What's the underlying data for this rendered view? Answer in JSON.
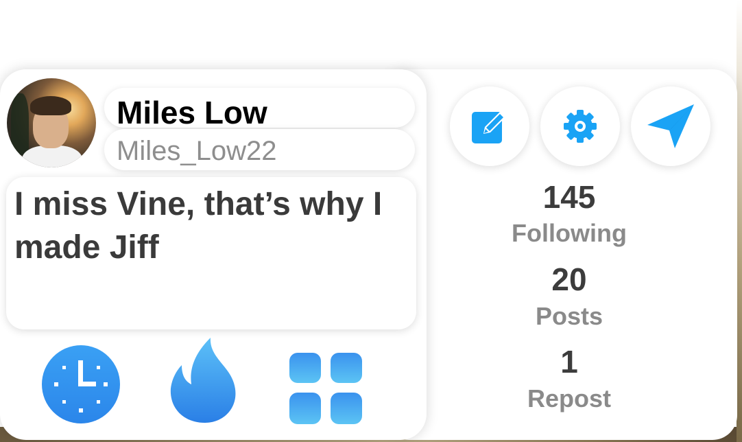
{
  "profile": {
    "name": "Miles Low",
    "username": "Miles_Low22",
    "bio": "I miss Vine, that’s why I made Jiff"
  },
  "actions": {
    "edit_icon": "edit-icon",
    "settings_icon": "gear-icon",
    "send_icon": "paper-plane-icon"
  },
  "nav": {
    "icons": [
      "clock-icon",
      "fire-icon",
      "grid-icon"
    ]
  },
  "stats": [
    {
      "value": "145",
      "label": "Following"
    },
    {
      "value": "20",
      "label": "Posts"
    },
    {
      "value": "1",
      "label": "Repost"
    }
  ],
  "colors": {
    "accent": "#1aa3f5",
    "primary_text": "#000000",
    "secondary_text": "#8e8e8e"
  }
}
